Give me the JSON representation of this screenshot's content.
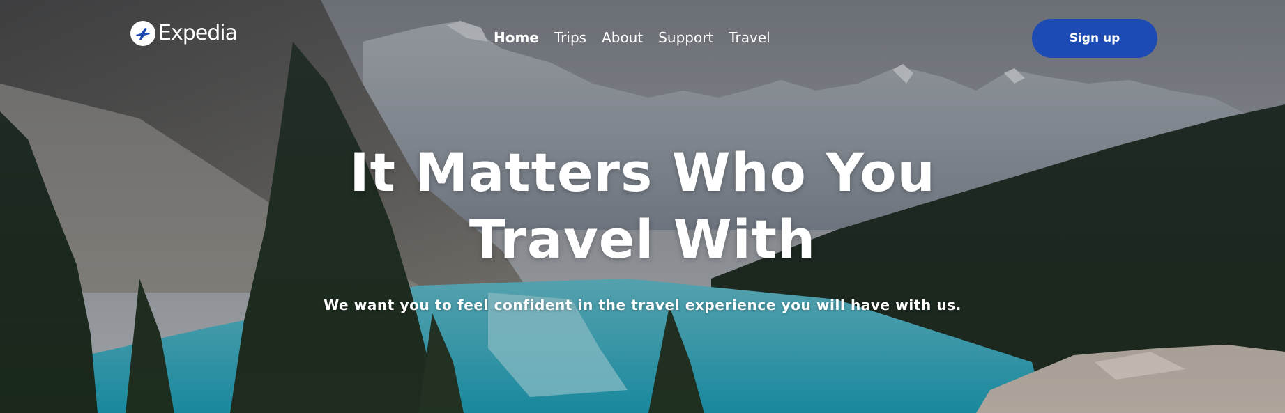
{
  "brand": {
    "name": "Expedia",
    "icon": "plane-icon"
  },
  "nav": {
    "items": [
      {
        "label": "Home",
        "active": true
      },
      {
        "label": "Trips",
        "active": false
      },
      {
        "label": "About",
        "active": false
      },
      {
        "label": "Support",
        "active": false
      },
      {
        "label": "Travel",
        "active": false
      }
    ]
  },
  "header": {
    "signup_label": "Sign up"
  },
  "hero": {
    "title_line1": "It Matters Who You",
    "title_line2": "Travel With",
    "subtitle": "We want you to feel confident in the travel experience you will have with us.",
    "image": "mountain-lake-photo"
  },
  "colors": {
    "button": "#1e4bb3",
    "text": "#ffffff",
    "lake": "#2aa3b8",
    "forest": "#1d2a1f"
  }
}
